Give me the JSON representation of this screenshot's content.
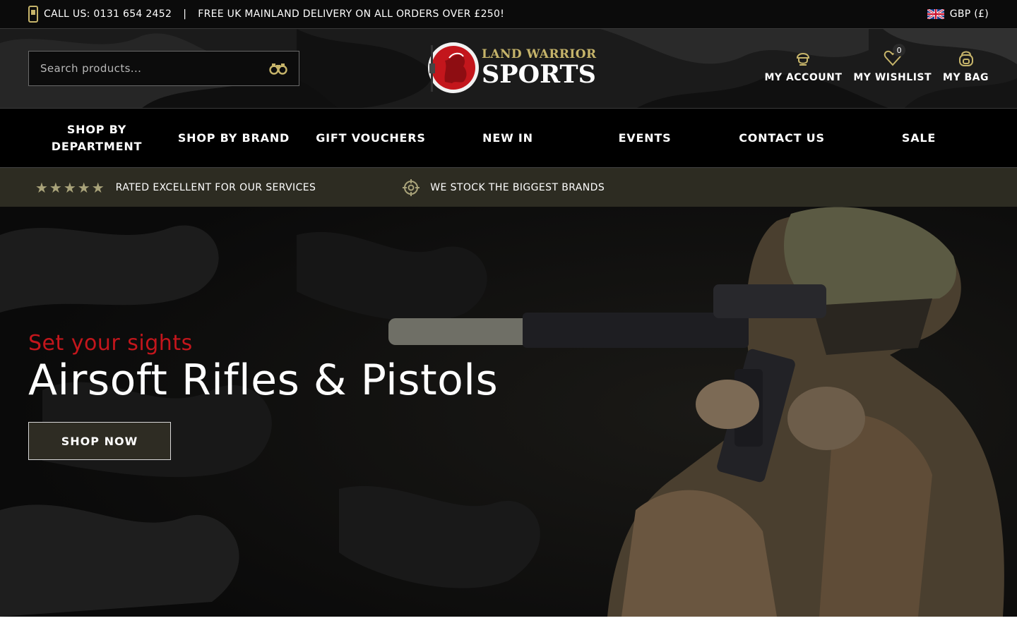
{
  "topbar": {
    "phone_text": "CALL US: 0131 654 2452",
    "separator": "|",
    "delivery_text": "FREE UK MAINLAND DELIVERY ON ALL ORDERS OVER £250!",
    "currency": "GBP (£)",
    "flag_icon": "uk-flag-icon"
  },
  "header": {
    "search": {
      "placeholder": "Search products..."
    },
    "logo": {
      "line1": "LAND WARRIOR",
      "line2": "SPORTS"
    },
    "account_label": "MY ACCOUNT",
    "wishlist_label": "MY WISHLIST",
    "wishlist_count": "0",
    "bag_label": "MY BAG"
  },
  "nav": {
    "items": [
      {
        "label": "SHOP BY DEPARTMENT"
      },
      {
        "label": "SHOP BY BRAND"
      },
      {
        "label": "GIFT VOUCHERS"
      },
      {
        "label": "NEW IN"
      },
      {
        "label": "EVENTS"
      },
      {
        "label": "CONTACT US"
      },
      {
        "label": "SALE"
      }
    ]
  },
  "usp": {
    "stars": "★★★★★",
    "rating_text": "RATED EXCELLENT FOR OUR SERVICES",
    "brands_text": "WE STOCK THE BIGGEST BRANDS"
  },
  "hero": {
    "eyebrow": "Set your sights",
    "title": "Airsoft Rifles & Pistols",
    "cta_label": "SHOP NOW"
  },
  "colors": {
    "accent_red": "#c3161c",
    "olive": "#c6b46a",
    "usp_bg": "#2d2c22",
    "button_bg": "#2e2c23"
  }
}
